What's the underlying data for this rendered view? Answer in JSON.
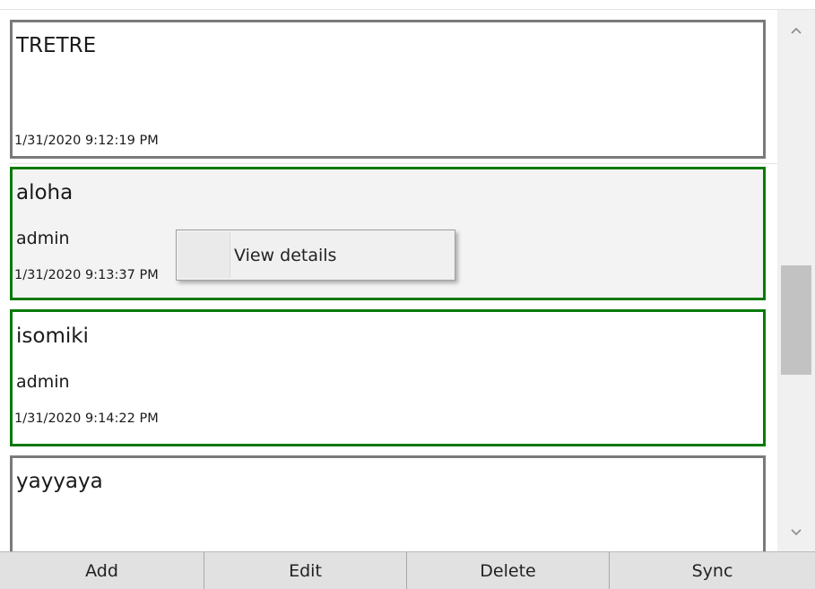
{
  "items": [
    {
      "title": "TRETRE",
      "author": "",
      "date": "1/31/2020 9:12:19 PM"
    },
    {
      "title": "aloha",
      "author": "admin",
      "date": "1/31/2020 9:13:37 PM"
    },
    {
      "title": "isomiki",
      "author": "admin",
      "date": "1/31/2020 9:14:22 PM"
    },
    {
      "title": "yayyaya",
      "author": "",
      "date": ""
    }
  ],
  "context_menu": {
    "view_details": "View details"
  },
  "toolbar": {
    "add": "Add",
    "edit": "Edit",
    "delete": "Delete",
    "sync": "Sync"
  },
  "icons": {
    "scroll_up": "chevron-up-icon",
    "scroll_down": "chevron-down-icon"
  },
  "colors": {
    "selected_border": "#0a7a0a",
    "item_border": "#7a7a7a"
  }
}
